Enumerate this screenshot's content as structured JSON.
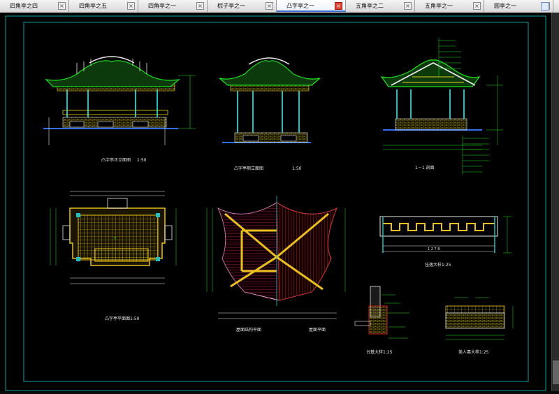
{
  "tabs": [
    {
      "label": "四角亭之四",
      "active": false
    },
    {
      "label": "四角亭之五",
      "active": false
    },
    {
      "label": "四角亭之一",
      "active": false
    },
    {
      "label": "棕子亭之一",
      "active": false
    },
    {
      "label": "凸字亭之一",
      "active": true
    },
    {
      "label": "五角亭之二",
      "active": false
    },
    {
      "label": "五角亭之一",
      "active": false
    },
    {
      "label": "圆亭之一",
      "active": false
    }
  ],
  "tab_close_glyph": "×",
  "drawing": {
    "front_elevation": {
      "title": "凸字亭正立面图",
      "scale": "1:50"
    },
    "side_elevation": {
      "title": "凸字亭侧立面图",
      "scale": "1:50"
    },
    "section": {
      "title": "1－1 剖面"
    },
    "plan": {
      "title": "凸字亭平面图1:50"
    },
    "roof_framing": {
      "title": "屋面结构平面"
    },
    "roof_plan": {
      "title": "屋面平面"
    },
    "railing": {
      "title": "挂落大样1:25",
      "dim": "1 2 7 8"
    },
    "base_detail": {
      "title": "台基大样1:25"
    },
    "bench_detail": {
      "title": "美人靠大样1:25"
    }
  },
  "colors": {
    "cad_bg": "#000000",
    "yellow": "#f0e020",
    "green": "#20e020",
    "white": "#e8e8e8",
    "cyan": "#10c8c8",
    "red": "#e02020",
    "magenta": "#e020a0",
    "frame": "#10a0a0"
  }
}
